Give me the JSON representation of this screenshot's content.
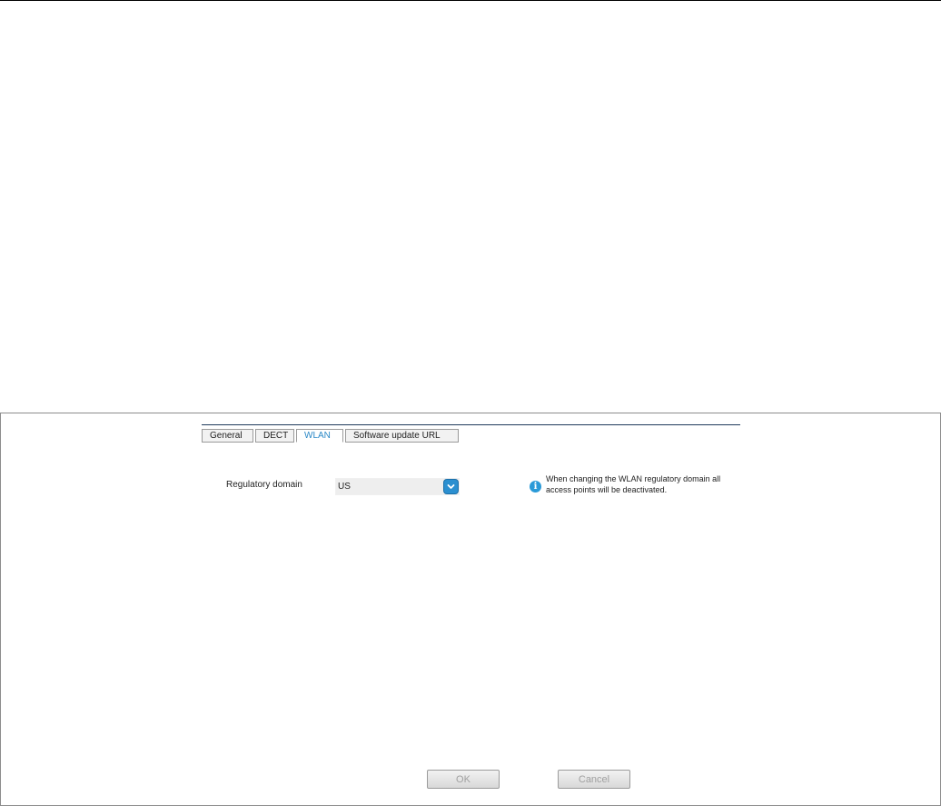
{
  "tabs": [
    {
      "label": "General"
    },
    {
      "label": "DECT"
    },
    {
      "label": "WLAN"
    },
    {
      "label": "Software update URL"
    }
  ],
  "active_tab": "WLAN",
  "form": {
    "regulatory_domain_label": "Regulatory domain",
    "regulatory_domain_value": "US",
    "info_text": "When changing the WLAN regulatory domain all access points will be deactivated."
  },
  "buttons": {
    "ok_label": "OK",
    "cancel_label": "Cancel"
  },
  "icons": {
    "dropdown": "chevron-down-icon",
    "info": "info-icon"
  },
  "colors": {
    "accent": "#2b8fd0",
    "active_tab_text": "#2a88c6"
  }
}
